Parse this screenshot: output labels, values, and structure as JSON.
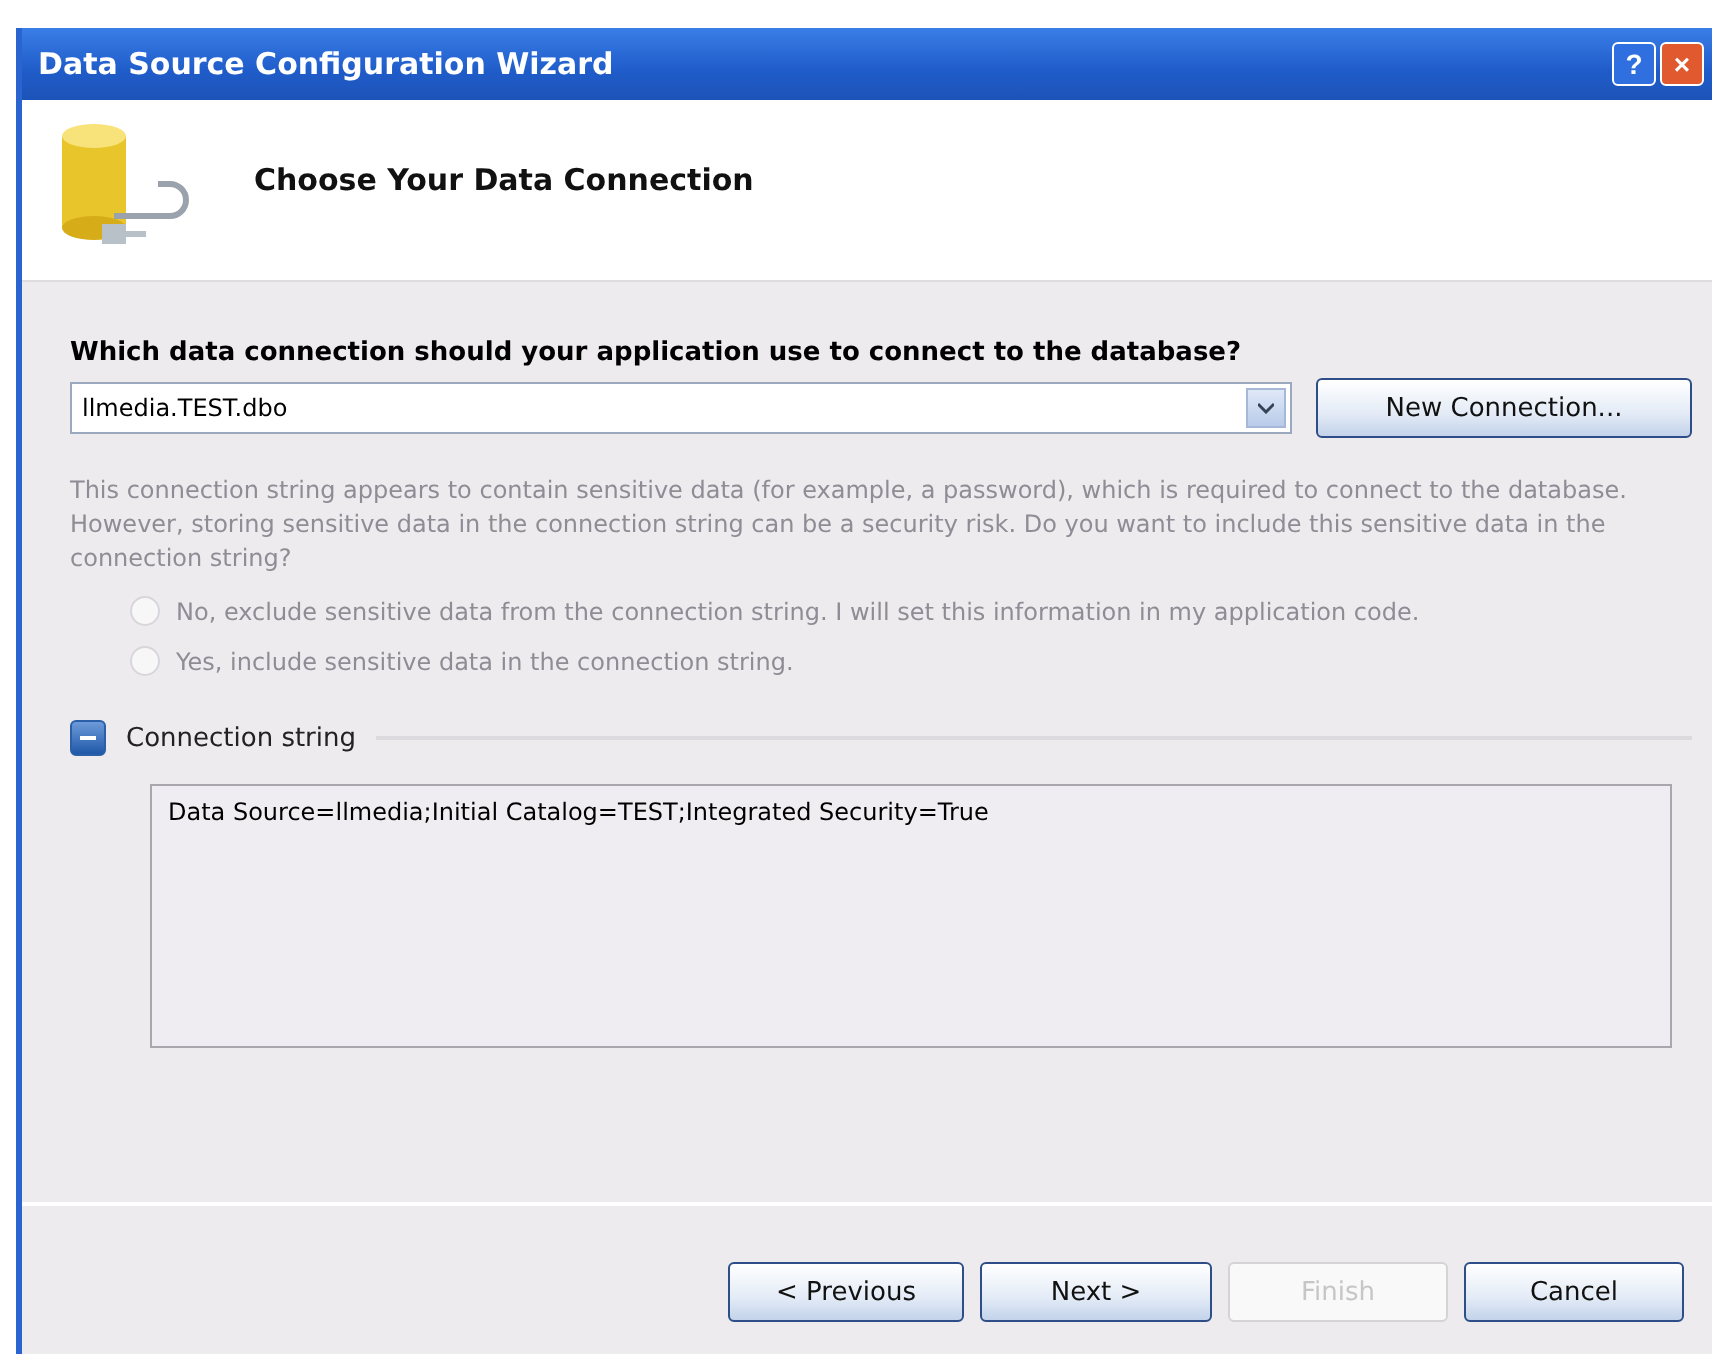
{
  "window": {
    "title": "Data Source Configuration Wizard",
    "help_button": "?",
    "close_button": "×"
  },
  "header": {
    "title": "Choose Your Data Connection"
  },
  "connection": {
    "question": "Which data connection should your application use to connect to the database?",
    "value": "llmedia.TEST.dbo",
    "new_button": "New Connection..."
  },
  "sensitive": {
    "disabled": true,
    "text": "This connection string appears to contain sensitive data (for example, a password), which is required to connect to the database. However, storing sensitive data in the connection string can be a security risk. Do you want to include this sensitive data in the connection string?",
    "options": [
      {
        "label": "No, exclude sensitive data from the connection string. I will set this information in my application code.",
        "selected": false
      },
      {
        "label": "Yes, include sensitive data in the connection string.",
        "selected": false
      }
    ]
  },
  "connection_string": {
    "label": "Connection string",
    "expanded": true,
    "value": "Data Source=llmedia;Initial Catalog=TEST;Integrated Security=True"
  },
  "buttons": [
    {
      "label": "< Previous",
      "disabled": false
    },
    {
      "label": "Next >",
      "disabled": false
    },
    {
      "label": "Finish",
      "disabled": true
    },
    {
      "label": "Cancel",
      "disabled": false
    }
  ]
}
